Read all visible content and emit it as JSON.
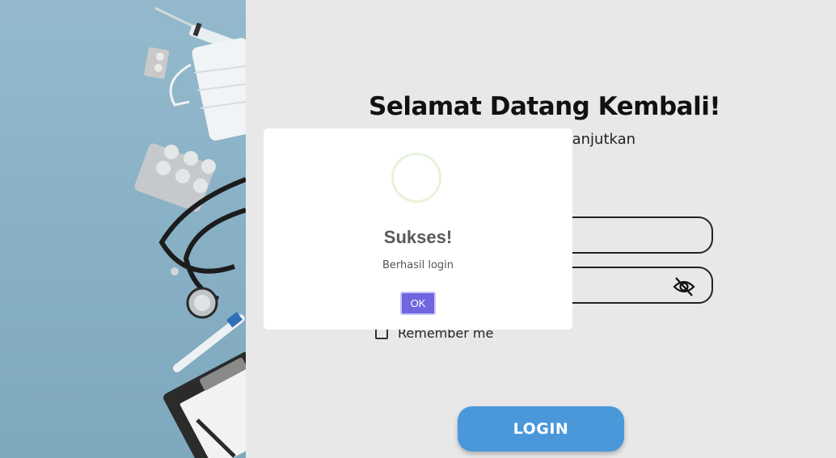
{
  "login": {
    "title": "Selamat Datang Kembali!",
    "subtitle": "melanjutkan",
    "email_value": "",
    "password_value": "",
    "remember_label": "Remember me",
    "login_button": "LOGIN",
    "toggle_icon": "eye-slash-icon"
  },
  "modal": {
    "icon": "success-circle-icon",
    "title": "Sukses!",
    "message": "Berhasil login",
    "ok_label": "OK"
  },
  "colors": {
    "login_button": "#4a98d9",
    "ok_button": "#7066e0",
    "background": "#e8e8e8",
    "image_panel": "#8fb5c9"
  }
}
